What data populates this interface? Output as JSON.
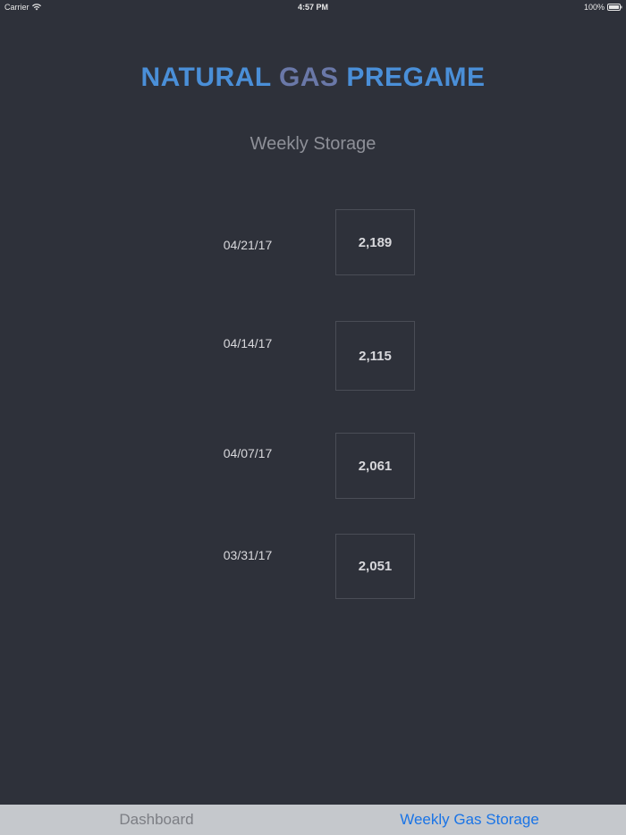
{
  "status_bar": {
    "carrier": "Carrier",
    "time": "4:57 PM",
    "battery": "100%"
  },
  "header": {
    "title_part1": "NATURAL",
    "title_part2": "GAS",
    "title_part3": "PREGAME",
    "subtitle": "Weekly Storage"
  },
  "storage": {
    "rows": [
      {
        "date": "04/21/17",
        "value": "2,189"
      },
      {
        "date": "04/14/17",
        "value": "2,115"
      },
      {
        "date": "04/07/17",
        "value": "2,061"
      },
      {
        "date": "03/31/17",
        "value": "2,051"
      }
    ]
  },
  "tab_bar": {
    "tabs": [
      {
        "label": "Dashboard",
        "selected": false
      },
      {
        "label": "Weekly Gas Storage",
        "selected": true
      }
    ]
  },
  "colors": {
    "background": "#2e313a",
    "title_blue": "#4a8fd8",
    "title_gas": "#6a78a8",
    "tab_active": "#1a74e6",
    "tab_inactive": "#7c7e84",
    "tab_bar_bg": "#c5c8cc"
  }
}
